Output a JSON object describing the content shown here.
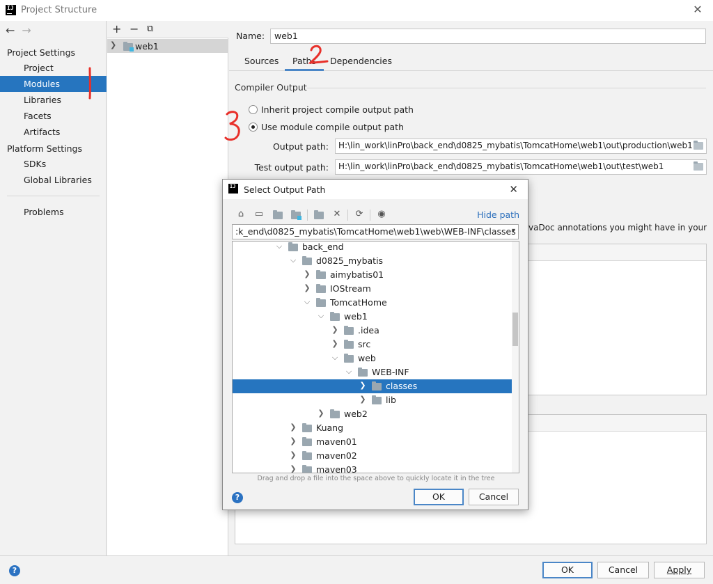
{
  "window": {
    "title": "Project Structure"
  },
  "nav": {
    "sections": [
      {
        "title": "Project Settings",
        "items": [
          "Project",
          "Modules",
          "Libraries",
          "Facets",
          "Artifacts"
        ]
      },
      {
        "title": "Platform Settings",
        "items": [
          "SDKs",
          "Global Libraries"
        ]
      }
    ],
    "extra": "Problems",
    "selected": "Modules"
  },
  "modules": {
    "items": [
      {
        "label": "web1"
      }
    ]
  },
  "module_panel": {
    "name_label": "Name:",
    "name_value": "web1",
    "tabs": [
      "Sources",
      "Paths",
      "Dependencies"
    ],
    "active_tab": "Paths",
    "compiler_output_title": "Compiler Output",
    "radio_inherit": "Inherit project compile output path",
    "radio_use_module": "Use module compile output path",
    "selected_radio": "Use module compile output path",
    "output_path_label": "Output path:",
    "output_path_value": "H:\\lin_work\\linPro\\back_end\\d0825_mybatis\\TomcatHome\\web1\\out\\production\\web1",
    "test_output_label": "Test output path:",
    "test_output_value": "H:\\lin_work\\linPro\\back_end\\d0825_mybatis\\TomcatHome\\web1\\out\\test\\web1",
    "javadoc_hint": "vaDoc annotations you might have in your"
  },
  "dialog": {
    "title": "Select Output Path",
    "hide_path": "Hide path",
    "path_value": ":k_end\\d0825_mybatis\\TomcatHome\\web1\\web\\WEB-INF\\classes",
    "tree": [
      {
        "label": "back_end",
        "depth": 0,
        "expanded": true
      },
      {
        "label": "d0825_mybatis",
        "depth": 1,
        "expanded": true
      },
      {
        "label": "aimybatis01",
        "depth": 2,
        "expanded": false
      },
      {
        "label": "IOStream",
        "depth": 2,
        "expanded": false
      },
      {
        "label": "TomcatHome",
        "depth": 2,
        "expanded": true
      },
      {
        "label": "web1",
        "depth": 3,
        "expanded": true
      },
      {
        "label": ".idea",
        "depth": 4,
        "expanded": false
      },
      {
        "label": "src",
        "depth": 4,
        "expanded": false
      },
      {
        "label": "web",
        "depth": 4,
        "expanded": true
      },
      {
        "label": "WEB-INF",
        "depth": 5,
        "expanded": true
      },
      {
        "label": "classes",
        "depth": 6,
        "expanded": false,
        "selected": true
      },
      {
        "label": "lib",
        "depth": 6,
        "expanded": false
      },
      {
        "label": "web2",
        "depth": 3,
        "expanded": false
      },
      {
        "label": "Kuang",
        "depth": 1,
        "expanded": false
      },
      {
        "label": "maven01",
        "depth": 1,
        "expanded": false
      },
      {
        "label": "maven02",
        "depth": 1,
        "expanded": false
      },
      {
        "label": "maven03",
        "depth": 1,
        "expanded": false
      }
    ],
    "drag_hint": "Drag and drop a file into the space above to quickly locate it in the tree",
    "ok": "OK",
    "cancel": "Cancel"
  },
  "footer": {
    "ok": "OK",
    "cancel": "Cancel",
    "apply": "Apply"
  },
  "annotations": {
    "color": "#e8302a"
  },
  "colors": {
    "selection": "#2675bf",
    "link": "#2a6ebb",
    "help": "#2b72c2"
  }
}
